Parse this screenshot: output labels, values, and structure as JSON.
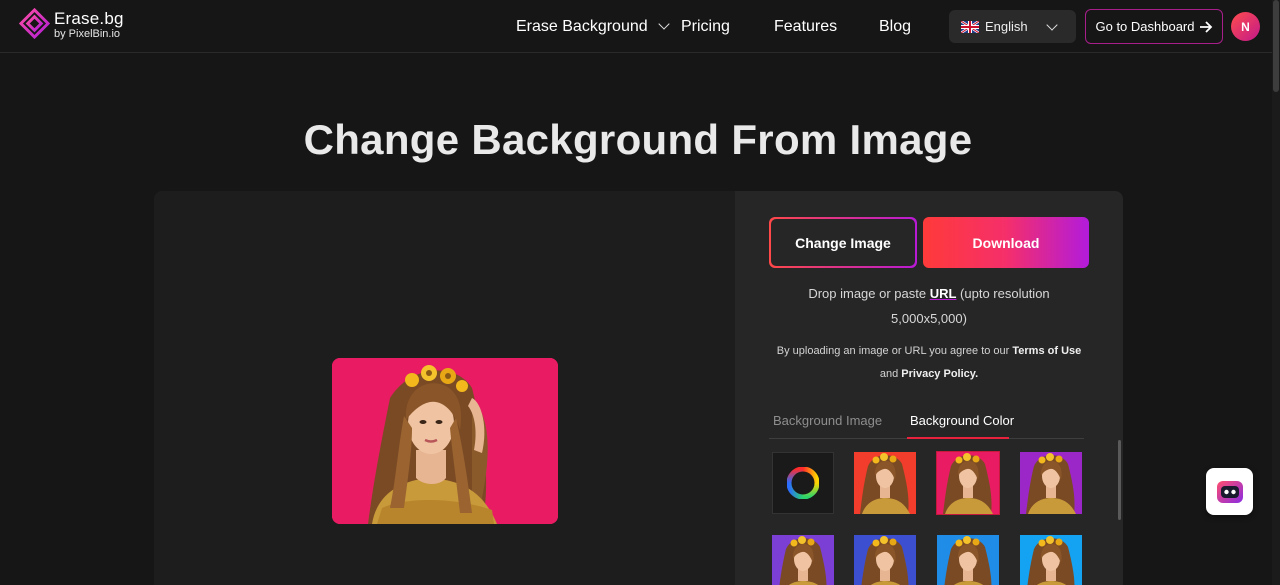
{
  "header": {
    "logo_title": "Erase.bg",
    "logo_sub": "by PixelBin.io",
    "nav": [
      {
        "label": "Erase Background"
      },
      {
        "label": "Pricing"
      },
      {
        "label": "Features"
      },
      {
        "label": "Blog"
      }
    ],
    "language": "English",
    "dashboard_label": "Go to Dashboard",
    "avatar_initial": "N"
  },
  "main": {
    "title": "Change Background From Image",
    "change_image_label": "Change Image",
    "download_label": "Download",
    "drop_text_before": "Drop image or paste ",
    "drop_text_link": "URL",
    "drop_text_after": " (upto resolution 5,000x5,000)",
    "terms_before": "By uploading an image or URL you agree to our ",
    "terms_link": "Terms of Use",
    "terms_mid": " and ",
    "privacy_link": "Privacy Policy.",
    "tabs": [
      {
        "label": "Background Image",
        "active": false
      },
      {
        "label": "Background Color",
        "active": true
      }
    ],
    "color_swatches": [
      "#f23c2c",
      "#e91c63",
      "#9b27c9",
      "#7b3fd6",
      "#3d4fd1",
      "#1f8de8",
      "#13a3f2"
    ],
    "selected_swatch": "#e91c63",
    "preview_background": "#e91c63"
  },
  "colors": {
    "accent_start": "#ff3a3a",
    "accent_end": "#b21bdb"
  }
}
